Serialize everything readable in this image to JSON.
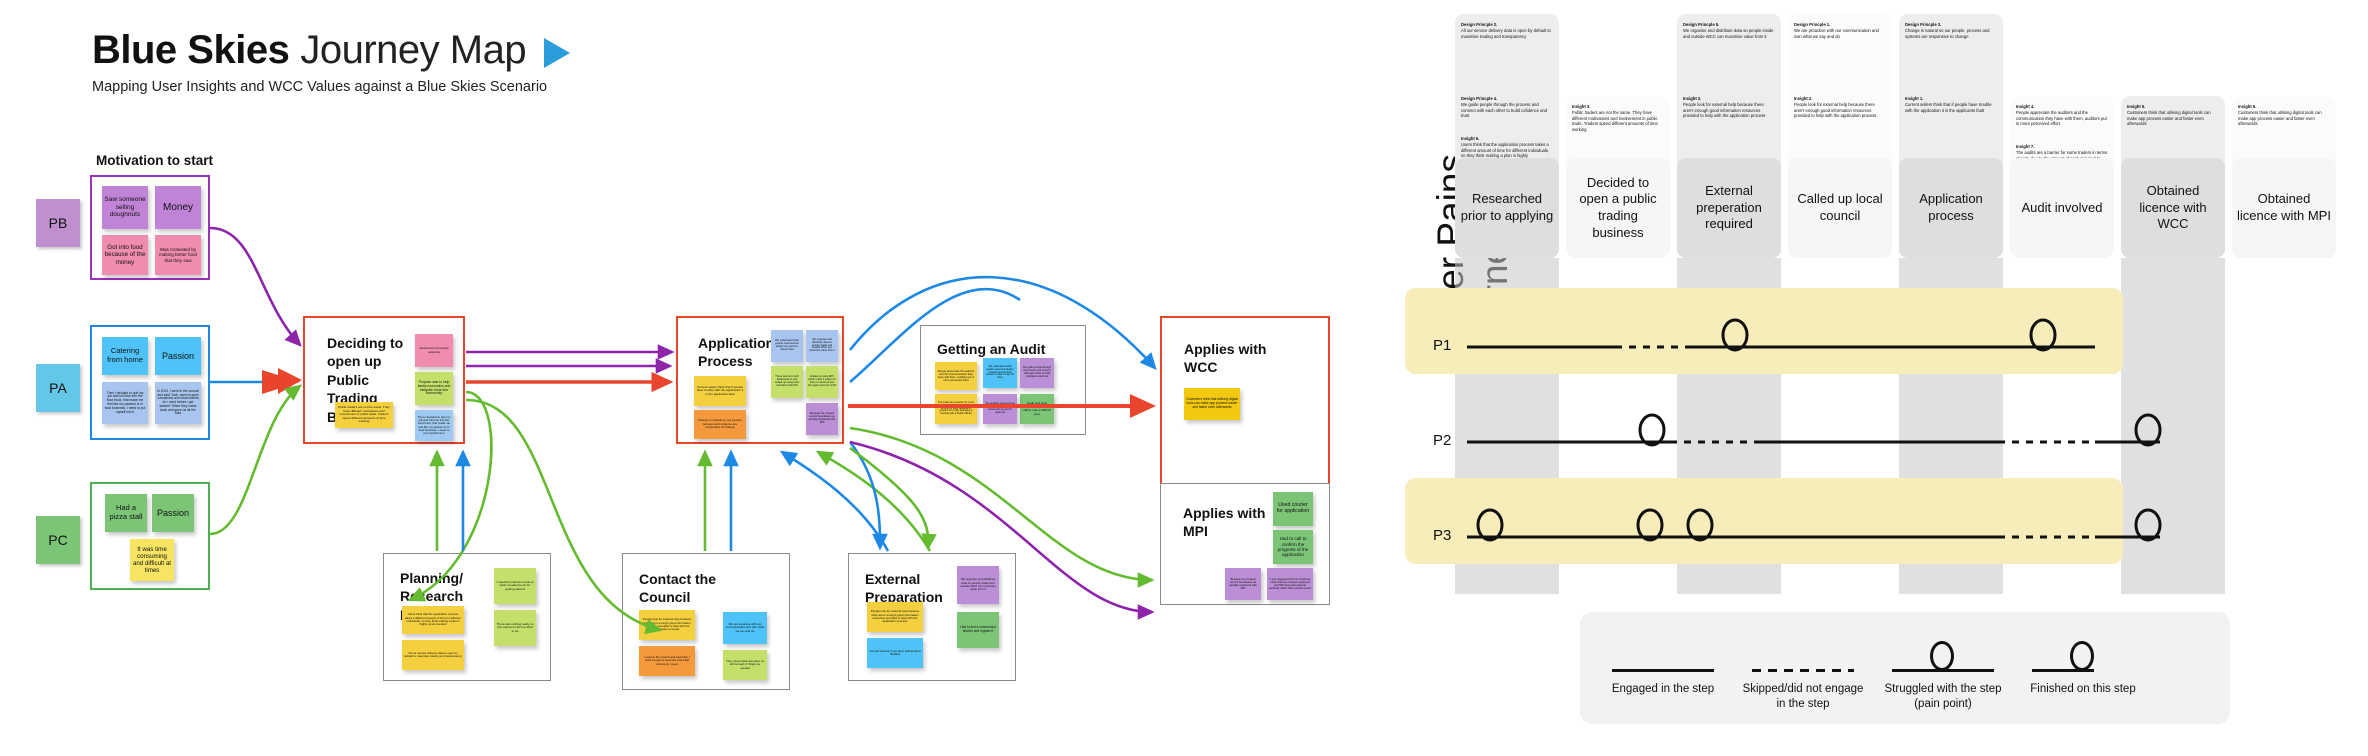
{
  "header": {
    "title_bold": "Blue Skies",
    "title_light": "Journey Map",
    "play_icon": "play-triangle-icon",
    "subtitle": "Mapping User Insights and WCC Values against a Blue Skies Scenario"
  },
  "personas": [
    {
      "code": "PB",
      "color": "#c08fd0",
      "group_label": "Motivation to start",
      "notes": [
        {
          "text": "Saw someone selling doughnuts",
          "color": "purple",
          "size": "lg"
        },
        {
          "text": "Money",
          "color": "purple",
          "size": "lg"
        },
        {
          "text": "Got into food because of the money",
          "color": "pink",
          "size": "sm"
        },
        {
          "text": "Was motivated by making better food that they saw",
          "color": "pink",
          "size": "xs"
        }
      ]
    },
    {
      "code": "PA",
      "color": "#63c8e8",
      "group_label": "",
      "notes": [
        {
          "text": "Catering from home",
          "color": "blue",
          "size": "lg"
        },
        {
          "text": "Passion",
          "color": "blue",
          "size": "lg"
        },
        {
          "text": "Then i decided to quit my job and full time into the food truck, that made me feel like my passion is in food business. I need to put myself into it",
          "color": "lblue",
          "size": "xs"
        },
        {
          "text": "In 2013, i went to the council and said \"look, want to open a business and what criteria do i need before i get started\" When they came back and gave us all the load",
          "color": "lblue",
          "size": "xs"
        }
      ]
    },
    {
      "code": "PC",
      "color": "#7cc576",
      "group_label": "",
      "notes": [
        {
          "text": "Had a pizza stall",
          "color": "green",
          "size": "lg"
        },
        {
          "text": "Passion",
          "color": "green",
          "size": "lg"
        },
        {
          "text": "It was time consuming and difficult at times",
          "color": "yellow2",
          "size": "sm"
        }
      ]
    }
  ],
  "stages": [
    {
      "id": "deciding",
      "title": "Deciding to open up Public Trading Business",
      "border": "red",
      "notes": [
        {
          "text": "Public traders are not the same. They have different motivations and involvement in public trade. Traders spend different amounts of time working",
          "color": "yellow",
          "size": "xs"
        },
        {
          "text": "Social and community networks",
          "color": "pink",
          "size": "xs"
        },
        {
          "text": "Purpose was to help family economics and integrate more into community",
          "color": "lgreen",
          "size": "xs"
        },
        {
          "text": "Then i decided to quit my job and full time into the food truck, that made me feel like my passion is in food business. I need to put myself into it",
          "color": "sky",
          "size": "xs"
        }
      ]
    },
    {
      "id": "application",
      "title": "Application Process",
      "border": "red",
      "notes": [
        {
          "text": "Current sellers think that if people have trouble with the application it is the applicants fault",
          "color": "yellow",
          "size": "xs"
        },
        {
          "text": "Change is natural so our people, process and systems are responsive to change",
          "color": "orange",
          "size": "xs"
        },
        {
          "text": "We understand what people need and we design our services around that",
          "color": "lblue",
          "size": "xs"
        },
        {
          "text": "We organise and distribute data so people inside and outside WCC can maximise value from it",
          "color": "lblue",
          "size": "xs"
        },
        {
          "text": "There was too much backwards to and ended up using tools and back and forth",
          "color": "lgreen",
          "size": "xs"
        },
        {
          "text": "Ended up using MPI which made it easier for them to travel across the region and out of NZ",
          "color": "lgreen",
          "size": "xs"
        },
        {
          "text": "Because we crossed council boundaries we actually registered with MPI",
          "color": "violet",
          "size": "xs"
        }
      ]
    },
    {
      "id": "audit",
      "title": "Getting an Audit",
      "border": "gray",
      "notes": [
        {
          "text": "People appreciate the auditors and the communication they have with them, auditors put in more perceived effort",
          "color": "yellow",
          "size": "xs"
        },
        {
          "text": "The audits are a barrier for some traders in terms of cost, due to the amount of work required to prepare for it (like arranging a meeting with a health officer)",
          "color": "yellow",
          "size": "xs"
        },
        {
          "text": "We understand what people need and design services around their needs to make it easy for them",
          "color": "blue",
          "size": "xs"
        },
        {
          "text": "Audit and food control meeting with officer was a difficult part",
          "color": "green",
          "size": "xs"
        },
        {
          "text": "We guide people through the process and connect with each other to build confidence and trust",
          "color": "violet",
          "size": "xs"
        },
        {
          "text": "The auditors came and we got all the requirements sorted and we got the approval",
          "color": "violet",
          "size": "xs"
        }
      ]
    },
    {
      "id": "wcc",
      "title": "Applies with WCC",
      "border": "red",
      "notes": [
        {
          "text": "Customers think that utilising digital tools can make app process easier and faster even afterwards",
          "color": "gold",
          "size": "xs"
        }
      ]
    },
    {
      "id": "mpi",
      "title": "Applies with MPI",
      "border": "gray",
      "notes": [
        {
          "text": "Used courier for application",
          "color": "green",
          "size": "sm"
        },
        {
          "text": "Had to call to confirm the progress of the application",
          "color": "green",
          "size": "sm"
        },
        {
          "text": "Because we crossed council boundaries we actually registered with MPI",
          "color": "violet",
          "size": "xs"
        },
        {
          "text": "It just happened with our business model that we crossed registered and MPI being the national authority rather than a local council",
          "color": "violet",
          "size": "xs"
        }
      ]
    },
    {
      "id": "planning",
      "title": "Planning/ Research Phase",
      "border": "gray",
      "notes": [
        {
          "text": "Users think that the application process takes a different amount of time for different individuals, so they think making a plan is highly recommended",
          "color": "yellow",
          "size": "xs"
        },
        {
          "text": "All our service delivery data is open by default to maximise trading and transparency",
          "color": "yellow",
          "size": "xs"
        },
        {
          "text": "I used the internet to look at what I needed to do for getting started",
          "color": "lgreen",
          "size": "xs"
        },
        {
          "text": "There was nothing really on the internet to tell me what to do",
          "color": "lgreen",
          "size": "xs"
        }
      ]
    },
    {
      "id": "council",
      "title": "Contact the Council (call)",
      "border": "gray",
      "notes": [
        {
          "text": "People look for external help because there aren't enough good information resources provided to help with the application process",
          "color": "yellow",
          "size": "xs"
        },
        {
          "text": "I went to the council and said look, I want to open a business and what criteria do I need",
          "color": "orange",
          "size": "xs"
        },
        {
          "text": "We are proactive with our communication and own what we say and do",
          "color": "blue",
          "size": "xs"
        },
        {
          "text": "They came back and gave us all the load of things we needed",
          "color": "lgreen",
          "size": "xs"
        }
      ]
    },
    {
      "id": "external",
      "title": "External Preparation",
      "border": "gray",
      "notes": [
        {
          "text": "People look for external help because there aren't enough good information resources provided to help with the application process",
          "color": "yellow",
          "size": "xs"
        },
        {
          "text": "Council will ask if you have kitchen/food facilities",
          "color": "blue",
          "size": "xs"
        },
        {
          "text": "We organise and distribute data so people inside and outside WCC can maximise value from it",
          "color": "violet",
          "size": "xs"
        },
        {
          "text": "Had to find a commercial kitchen and register it",
          "color": "green",
          "size": "xs"
        }
      ]
    }
  ],
  "journey_map": {
    "vtitle_line1": "User Pains",
    "vtitle_line2": "Journey Map",
    "columns": [
      {
        "head": "Researched prior to applying",
        "shaded": true,
        "annotations": [
          {
            "title": "Design Princple 2.",
            "body": "All our service delivery data is open by default to maximise trading and transparency"
          },
          {
            "title": "Design Princple 4.",
            "body": "We guide people through the process and connect with each other to build cofidence and trust"
          },
          {
            "title": "Insight 6.",
            "body": "Users think that the application process takes a different amount of time for different individuals, so they think making a plan is highly recommended"
          }
        ]
      },
      {
        "head": "Decided to open a public trading business",
        "shaded": false,
        "annotations": [
          {
            "title": "Insight 3.",
            "body": "Public traders are not the same. They have different motivations and involvement in public trade. Traders spend different amounts of time working"
          }
        ]
      },
      {
        "head": "External preperation required",
        "shaded": true,
        "annotations": [
          {
            "title": "Design Princple 5.",
            "body": "We organise and distribute data so people inside and outside WCC can maximise value from it"
          },
          {
            "title": "Insight 2.",
            "body": "People look for external help because there aren't enough good information resources provided to help with the application process"
          }
        ]
      },
      {
        "head": "Called up local council",
        "shaded": false,
        "annotations": [
          {
            "title": "Design Princple 1.",
            "body": "We are proactive with our communication and own what we say and do"
          },
          {
            "title": "Insight 2.",
            "body": "People look for external help because there aren't enough good information resources provided to help with the application process"
          }
        ]
      },
      {
        "head": "Application process",
        "shaded": true,
        "annotations": [
          {
            "title": "Design Princple 3.",
            "body": "Change is natural so our people, process and systems are responsive to change"
          },
          {
            "title": "Insight 1.",
            "body": "Current sellers think that if people have trouble with the application it is the applicants fault"
          }
        ]
      },
      {
        "head": "Audit involved",
        "shaded": false,
        "annotations": [
          {
            "title": "Insight 4.",
            "body": "People appreciate the  auditors and the communication they have with them, auditors put in more perceived effort"
          },
          {
            "title": "Insight 7.",
            "body": "The audits are a barrier for some traders in terms of cost, due to the amount of work required to prepare for it (like arranging a meeting with a health officer)."
          }
        ]
      },
      {
        "head": "Obtained licence with WCC",
        "shaded": true,
        "annotations": [
          {
            "title": "Insight 5.",
            "body": "Customers think that utilising digital tools can make app process easier and faster even afterwards"
          }
        ]
      },
      {
        "head": "Obtained licence with MPI",
        "shaded": false,
        "annotations": [
          {
            "title": "Insight 5.",
            "body": "Customers think that utilising digital tools can make app process easier and faster even afterwards"
          }
        ]
      }
    ],
    "rows": [
      {
        "label": "P1",
        "highlight": true
      },
      {
        "label": "P2",
        "highlight": false
      },
      {
        "label": "P3",
        "highlight": true
      }
    ]
  },
  "legend": {
    "items": [
      {
        "marker": "solid-line-icon",
        "caption": "Engaged in the step"
      },
      {
        "marker": "dashed-line-icon",
        "caption": "Skipped/did not engage in the step"
      },
      {
        "marker": "loop-marker-icon",
        "caption": "Struggled with the step (pain point)"
      },
      {
        "marker": "loop-end-icon",
        "caption": "Finished on this step"
      }
    ]
  },
  "chart_data": {
    "type": "line",
    "title": "User Pains Journey Map",
    "categories": [
      "Researched prior to applying",
      "Decided to open a public trading business",
      "External preperation required",
      "Called up local council",
      "Application process",
      "Audit involved",
      "Obtained licence with WCC",
      "Obtained licence with MPI"
    ],
    "series": [
      {
        "name": "P1",
        "segments": [
          "solid",
          "solid",
          "dashed",
          "solid",
          "solid",
          "solid",
          "solid",
          ""
        ],
        "loops": [
          4,
          7
        ],
        "end": 7
      },
      {
        "name": "P2",
        "segments": [
          "solid",
          "solid",
          "solid",
          "dashed",
          "dashed",
          "dashed",
          "dashed",
          ""
        ],
        "loops": [
          2
        ],
        "end": 8
      },
      {
        "name": "P3",
        "segments": [
          "solid",
          "solid",
          "solid",
          "solid",
          "solid",
          "solid",
          "dashed",
          ""
        ],
        "loops": [
          1,
          3,
          4
        ],
        "end": 8
      }
    ],
    "legend_position": "bottom"
  }
}
